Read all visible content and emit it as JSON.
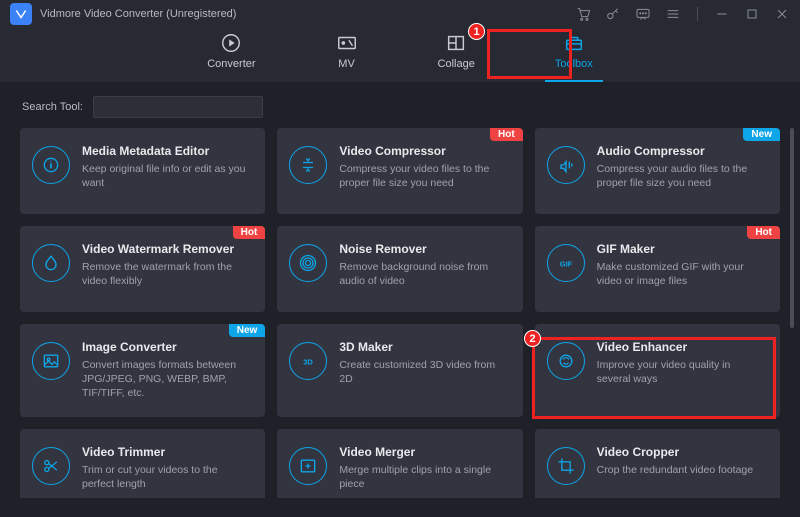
{
  "app": {
    "title": "Vidmore Video Converter (Unregistered)"
  },
  "nav": {
    "converter": "Converter",
    "mv": "MV",
    "collage": "Collage",
    "toolbox": "Toolbox"
  },
  "search": {
    "label": "Search Tool:"
  },
  "badges": {
    "hot": "Hot",
    "new": "New"
  },
  "tools": [
    {
      "title": "Media Metadata Editor",
      "desc": "Keep original file info or edit as you want",
      "badge": null,
      "icon": "info"
    },
    {
      "title": "Video Compressor",
      "desc": "Compress your video files to the proper file size you need",
      "badge": "hot",
      "icon": "compress"
    },
    {
      "title": "Audio Compressor",
      "desc": "Compress your audio files to the proper file size you need",
      "badge": "new",
      "icon": "audio-compress"
    },
    {
      "title": "Video Watermark Remover",
      "desc": "Remove the watermark from the video flexibly",
      "badge": "hot",
      "icon": "watermark"
    },
    {
      "title": "Noise Remover",
      "desc": "Remove background noise from audio of video",
      "badge": null,
      "icon": "noise"
    },
    {
      "title": "GIF Maker",
      "desc": "Make customized GIF with your video or image files",
      "badge": "hot",
      "icon": "gif"
    },
    {
      "title": "Image Converter",
      "desc": "Convert images formats between JPG/JPEG, PNG, WEBP, BMP, TIF/TIFF, etc.",
      "badge": "new",
      "icon": "image"
    },
    {
      "title": "3D Maker",
      "desc": "Create customized 3D video from 2D",
      "badge": null,
      "icon": "3d"
    },
    {
      "title": "Video Enhancer",
      "desc": "Improve your video quality in several ways",
      "badge": null,
      "icon": "enhance"
    },
    {
      "title": "Video Trimmer",
      "desc": "Trim or cut your videos to the perfect length",
      "badge": null,
      "icon": "trim"
    },
    {
      "title": "Video Merger",
      "desc": "Merge multiple clips into a single piece",
      "badge": null,
      "icon": "merge"
    },
    {
      "title": "Video Cropper",
      "desc": "Crop the redundant video footage",
      "badge": null,
      "icon": "crop"
    }
  ],
  "annotations": {
    "n1": "1",
    "n2": "2"
  }
}
